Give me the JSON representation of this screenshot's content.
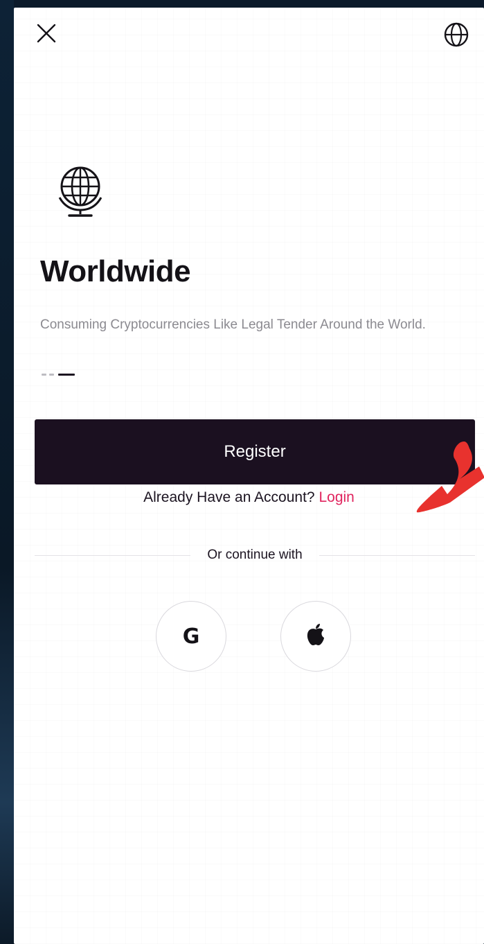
{
  "header": {
    "close_icon": "close-icon",
    "language_icon": "globe-icon"
  },
  "onboarding": {
    "hero_icon": "globe-stand-icon",
    "title": "Worldwide",
    "subtitle": "Consuming Cryptocurrencies Like Legal Tender Around the World.",
    "page_indicator": {
      "total": 3,
      "active_index": 2
    }
  },
  "actions": {
    "register_label": "Register",
    "login_prompt": "Already Have an Account?",
    "login_link": "Login"
  },
  "social": {
    "divider_label": "Or continue with",
    "google_label": "G",
    "google_icon": "google-icon",
    "apple_icon": "apple-icon"
  },
  "colors": {
    "primary_button": "#1b1020",
    "link_accent": "#e0245e",
    "annotation_arrow": "#e8322e"
  }
}
